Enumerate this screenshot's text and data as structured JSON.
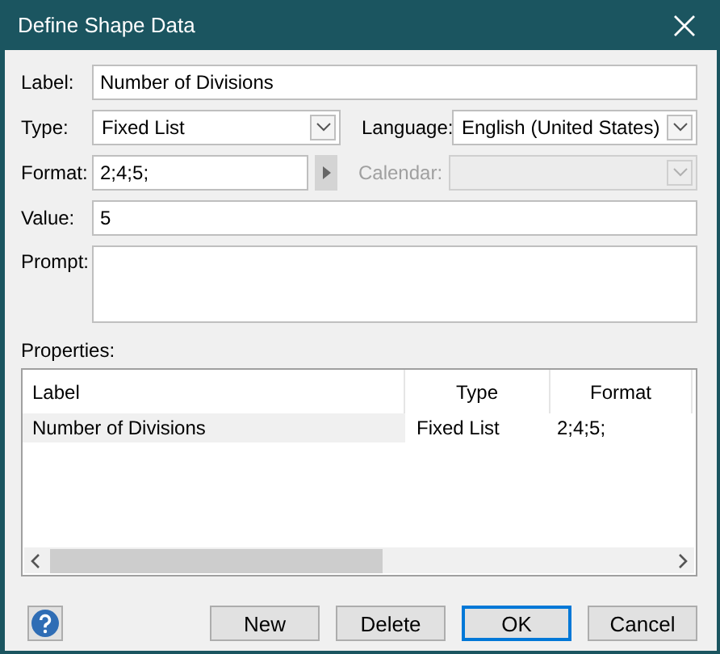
{
  "window": {
    "title": "Define Shape Data"
  },
  "fields": {
    "label": {
      "caption": "Label:",
      "value": "Number of Divisions"
    },
    "type": {
      "caption": "Type:",
      "value": "Fixed List"
    },
    "language": {
      "caption": "Language:",
      "value": "English (United States)"
    },
    "format": {
      "caption": "Format:",
      "value": "2;4;5;"
    },
    "calendar": {
      "caption": "Calendar:",
      "disabled": true
    },
    "value": {
      "caption": "Value:",
      "value": "5"
    },
    "prompt": {
      "caption": "Prompt:"
    }
  },
  "properties": {
    "caption": "Properties:",
    "columns": [
      "Label",
      "Type",
      "Format"
    ],
    "rows": [
      {
        "cells": [
          "Number of Divisions",
          "Fixed List",
          "2;4;5;"
        ],
        "selected": true
      }
    ]
  },
  "buttons": [
    {
      "label": "New",
      "default": false
    },
    {
      "label": "Delete",
      "default": false
    },
    {
      "label": "OK",
      "default": true
    },
    {
      "label": "Cancel",
      "default": false
    }
  ]
}
